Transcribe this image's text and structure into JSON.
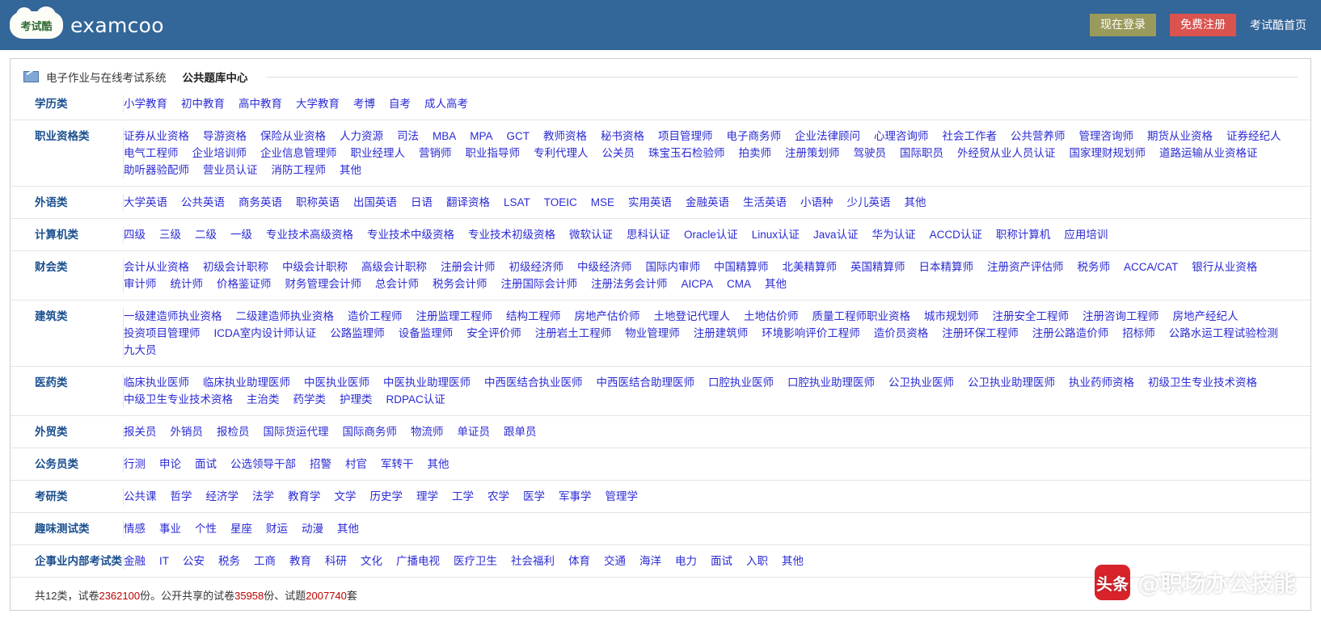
{
  "header": {
    "logo_badge": "考试酷",
    "brand": "examcoo",
    "login_label": "现在登录",
    "register_label": "免费注册",
    "home_label": "考试酷首页"
  },
  "panel": {
    "system_title": "电子作业与在线考试系统",
    "section_title": "公共题库中心",
    "icon": "pencil-icon"
  },
  "colors": {
    "topbar": "#336699",
    "login_button": "#9a9a5c",
    "register_button": "#d9534f",
    "category_label": "#1a4f8f",
    "link": "#2b2bd4",
    "highlight_number": "#c00000"
  },
  "categories": [
    {
      "name": "学历类",
      "links": [
        "小学教育",
        "初中教育",
        "高中教育",
        "大学教育",
        "考博",
        "自考",
        "成人高考"
      ]
    },
    {
      "name": "职业资格类",
      "links": [
        "证券从业资格",
        "导游资格",
        "保险从业资格",
        "人力资源",
        "司法",
        "MBA",
        "MPA",
        "GCT",
        "教师资格",
        "秘书资格",
        "项目管理师",
        "电子商务师",
        "企业法律顾问",
        "心理咨询师",
        "社会工作者",
        "公共营养师",
        "管理咨询师",
        "期货从业资格",
        "证券经纪人",
        "电气工程师",
        "企业培训师",
        "企业信息管理师",
        "职业经理人",
        "营销师",
        "职业指导师",
        "专利代理人",
        "公关员",
        "珠宝玉石检验师",
        "拍卖师",
        "注册策划师",
        "驾驶员",
        "国际职员",
        "外经贸从业人员认证",
        "国家理财规划师",
        "道路运输从业资格证",
        "助听器验配师",
        "营业员认证",
        "消防工程师",
        "其他"
      ]
    },
    {
      "name": "外语类",
      "links": [
        "大学英语",
        "公共英语",
        "商务英语",
        "职称英语",
        "出国英语",
        "日语",
        "翻译资格",
        "LSAT",
        "TOEIC",
        "MSE",
        "实用英语",
        "金融英语",
        "生活英语",
        "小语种",
        "少儿英语",
        "其他"
      ]
    },
    {
      "name": "计算机类",
      "links": [
        "四级",
        "三级",
        "二级",
        "一级",
        "专业技术高级资格",
        "专业技术中级资格",
        "专业技术初级资格",
        "微软认证",
        "思科认证",
        "Oracle认证",
        "Linux认证",
        "Java认证",
        "华为认证",
        "ACCD认证",
        "职称计算机",
        "应用培训"
      ]
    },
    {
      "name": "财会类",
      "links": [
        "会计从业资格",
        "初级会计职称",
        "中级会计职称",
        "高级会计职称",
        "注册会计师",
        "初级经济师",
        "中级经济师",
        "国际内审师",
        "中国精算师",
        "北美精算师",
        "英国精算师",
        "日本精算师",
        "注册资产评估师",
        "税务师",
        "ACCA/CAT",
        "银行从业资格",
        "审计师",
        "统计师",
        "价格鉴证师",
        "财务管理会计师",
        "总会计师",
        "税务会计师",
        "注册国际会计师",
        "注册法务会计师",
        "AICPA",
        "CMA",
        "其他"
      ]
    },
    {
      "name": "建筑类",
      "links": [
        "一级建造师执业资格",
        "二级建造师执业资格",
        "造价工程师",
        "注册监理工程师",
        "结构工程师",
        "房地产估价师",
        "土地登记代理人",
        "土地估价师",
        "质量工程师职业资格",
        "城市规划师",
        "注册安全工程师",
        "注册咨询工程师",
        "房地产经纪人",
        "投资项目管理师",
        "ICDA室内设计师认证",
        "公路监理师",
        "设备监理师",
        "安全评价师",
        "注册岩土工程师",
        "物业管理师",
        "注册建筑师",
        "环境影响评价工程师",
        "造价员资格",
        "注册环保工程师",
        "注册公路造价师",
        "招标师",
        "公路水运工程试验检测",
        "九大员"
      ]
    },
    {
      "name": "医药类",
      "links": [
        "临床执业医师",
        "临床执业助理医师",
        "中医执业医师",
        "中医执业助理医师",
        "中西医结合执业医师",
        "中西医结合助理医师",
        "口腔执业医师",
        "口腔执业助理医师",
        "公卫执业医师",
        "公卫执业助理医师",
        "执业药师资格",
        "初级卫生专业技术资格",
        "中级卫生专业技术资格",
        "主治类",
        "药学类",
        "护理类",
        "RDPAC认证"
      ]
    },
    {
      "name": "外贸类",
      "links": [
        "报关员",
        "外销员",
        "报检员",
        "国际货运代理",
        "国际商务师",
        "物流师",
        "单证员",
        "跟单员"
      ]
    },
    {
      "name": "公务员类",
      "links": [
        "行测",
        "申论",
        "面试",
        "公选领导干部",
        "招警",
        "村官",
        "军转干",
        "其他"
      ]
    },
    {
      "name": "考研类",
      "links": [
        "公共课",
        "哲学",
        "经济学",
        "法学",
        "教育学",
        "文学",
        "历史学",
        "理学",
        "工学",
        "农学",
        "医学",
        "军事学",
        "管理学"
      ]
    },
    {
      "name": "趣味测试类",
      "links": [
        "情感",
        "事业",
        "个性",
        "星座",
        "财运",
        "动漫",
        "其他"
      ]
    },
    {
      "name": "企事业内部考试类",
      "links": [
        "金融",
        "IT",
        "公安",
        "税务",
        "工商",
        "教育",
        "科研",
        "文化",
        "广播电视",
        "医疗卫生",
        "社会福利",
        "体育",
        "交通",
        "海洋",
        "电力",
        "面试",
        "入职",
        "其他"
      ]
    }
  ],
  "summary": {
    "prefix": "共12类，试卷",
    "papers_count": "2362100",
    "mid1": "份。公开共享的试卷",
    "shared_papers": "35958",
    "mid2": "份、试题",
    "questions": "2007740",
    "suffix": "套"
  },
  "watermark": {
    "logo": "头条",
    "text": "@职场办公技能"
  }
}
